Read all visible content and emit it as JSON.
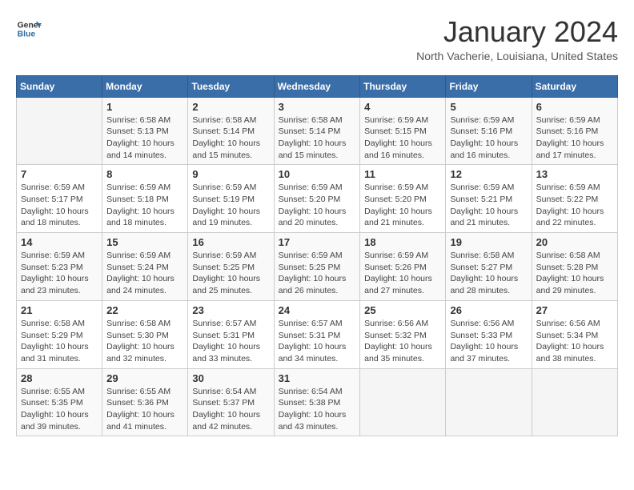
{
  "logo": {
    "general": "General",
    "blue": "Blue"
  },
  "header": {
    "title": "January 2024",
    "subtitle": "North Vacherie, Louisiana, United States"
  },
  "calendar": {
    "days_of_week": [
      "Sunday",
      "Monday",
      "Tuesday",
      "Wednesday",
      "Thursday",
      "Friday",
      "Saturday"
    ],
    "weeks": [
      [
        {
          "day": "",
          "info": ""
        },
        {
          "day": "1",
          "info": "Sunrise: 6:58 AM\nSunset: 5:13 PM\nDaylight: 10 hours\nand 14 minutes."
        },
        {
          "day": "2",
          "info": "Sunrise: 6:58 AM\nSunset: 5:14 PM\nDaylight: 10 hours\nand 15 minutes."
        },
        {
          "day": "3",
          "info": "Sunrise: 6:58 AM\nSunset: 5:14 PM\nDaylight: 10 hours\nand 15 minutes."
        },
        {
          "day": "4",
          "info": "Sunrise: 6:59 AM\nSunset: 5:15 PM\nDaylight: 10 hours\nand 16 minutes."
        },
        {
          "day": "5",
          "info": "Sunrise: 6:59 AM\nSunset: 5:16 PM\nDaylight: 10 hours\nand 16 minutes."
        },
        {
          "day": "6",
          "info": "Sunrise: 6:59 AM\nSunset: 5:16 PM\nDaylight: 10 hours\nand 17 minutes."
        }
      ],
      [
        {
          "day": "7",
          "info": "Sunrise: 6:59 AM\nSunset: 5:17 PM\nDaylight: 10 hours\nand 18 minutes."
        },
        {
          "day": "8",
          "info": "Sunrise: 6:59 AM\nSunset: 5:18 PM\nDaylight: 10 hours\nand 18 minutes."
        },
        {
          "day": "9",
          "info": "Sunrise: 6:59 AM\nSunset: 5:19 PM\nDaylight: 10 hours\nand 19 minutes."
        },
        {
          "day": "10",
          "info": "Sunrise: 6:59 AM\nSunset: 5:20 PM\nDaylight: 10 hours\nand 20 minutes."
        },
        {
          "day": "11",
          "info": "Sunrise: 6:59 AM\nSunset: 5:20 PM\nDaylight: 10 hours\nand 21 minutes."
        },
        {
          "day": "12",
          "info": "Sunrise: 6:59 AM\nSunset: 5:21 PM\nDaylight: 10 hours\nand 21 minutes."
        },
        {
          "day": "13",
          "info": "Sunrise: 6:59 AM\nSunset: 5:22 PM\nDaylight: 10 hours\nand 22 minutes."
        }
      ],
      [
        {
          "day": "14",
          "info": "Sunrise: 6:59 AM\nSunset: 5:23 PM\nDaylight: 10 hours\nand 23 minutes."
        },
        {
          "day": "15",
          "info": "Sunrise: 6:59 AM\nSunset: 5:24 PM\nDaylight: 10 hours\nand 24 minutes."
        },
        {
          "day": "16",
          "info": "Sunrise: 6:59 AM\nSunset: 5:25 PM\nDaylight: 10 hours\nand 25 minutes."
        },
        {
          "day": "17",
          "info": "Sunrise: 6:59 AM\nSunset: 5:25 PM\nDaylight: 10 hours\nand 26 minutes."
        },
        {
          "day": "18",
          "info": "Sunrise: 6:59 AM\nSunset: 5:26 PM\nDaylight: 10 hours\nand 27 minutes."
        },
        {
          "day": "19",
          "info": "Sunrise: 6:58 AM\nSunset: 5:27 PM\nDaylight: 10 hours\nand 28 minutes."
        },
        {
          "day": "20",
          "info": "Sunrise: 6:58 AM\nSunset: 5:28 PM\nDaylight: 10 hours\nand 29 minutes."
        }
      ],
      [
        {
          "day": "21",
          "info": "Sunrise: 6:58 AM\nSunset: 5:29 PM\nDaylight: 10 hours\nand 31 minutes."
        },
        {
          "day": "22",
          "info": "Sunrise: 6:58 AM\nSunset: 5:30 PM\nDaylight: 10 hours\nand 32 minutes."
        },
        {
          "day": "23",
          "info": "Sunrise: 6:57 AM\nSunset: 5:31 PM\nDaylight: 10 hours\nand 33 minutes."
        },
        {
          "day": "24",
          "info": "Sunrise: 6:57 AM\nSunset: 5:31 PM\nDaylight: 10 hours\nand 34 minutes."
        },
        {
          "day": "25",
          "info": "Sunrise: 6:56 AM\nSunset: 5:32 PM\nDaylight: 10 hours\nand 35 minutes."
        },
        {
          "day": "26",
          "info": "Sunrise: 6:56 AM\nSunset: 5:33 PM\nDaylight: 10 hours\nand 37 minutes."
        },
        {
          "day": "27",
          "info": "Sunrise: 6:56 AM\nSunset: 5:34 PM\nDaylight: 10 hours\nand 38 minutes."
        }
      ],
      [
        {
          "day": "28",
          "info": "Sunrise: 6:55 AM\nSunset: 5:35 PM\nDaylight: 10 hours\nand 39 minutes."
        },
        {
          "day": "29",
          "info": "Sunrise: 6:55 AM\nSunset: 5:36 PM\nDaylight: 10 hours\nand 41 minutes."
        },
        {
          "day": "30",
          "info": "Sunrise: 6:54 AM\nSunset: 5:37 PM\nDaylight: 10 hours\nand 42 minutes."
        },
        {
          "day": "31",
          "info": "Sunrise: 6:54 AM\nSunset: 5:38 PM\nDaylight: 10 hours\nand 43 minutes."
        },
        {
          "day": "",
          "info": ""
        },
        {
          "day": "",
          "info": ""
        },
        {
          "day": "",
          "info": ""
        }
      ]
    ]
  }
}
